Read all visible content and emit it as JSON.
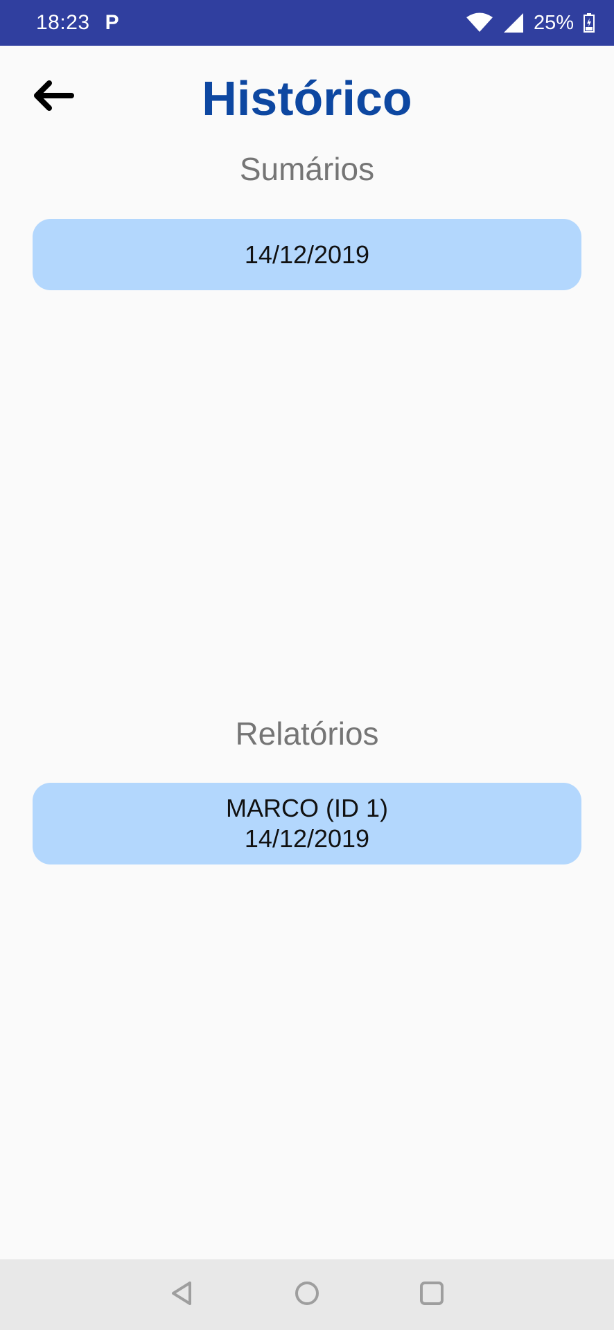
{
  "status_bar": {
    "time": "18:23",
    "notification_icon": "P",
    "battery": "25%",
    "icons": [
      "wifi-icon",
      "signal-icon",
      "battery-icon"
    ]
  },
  "header": {
    "back_icon": "arrow-left-icon",
    "title": "Histórico"
  },
  "summaries": {
    "title": "Sumários",
    "items": [
      {
        "date": "14/12/2019"
      }
    ]
  },
  "reports": {
    "title": "Relatórios",
    "items": [
      {
        "name": "MARCO (ID 1)",
        "date": "14/12/2019"
      }
    ]
  },
  "nav_bar": {
    "icons": [
      "back-triangle-icon",
      "home-circle-icon",
      "recents-square-icon"
    ]
  },
  "colors": {
    "status_bar": "#303f9f",
    "title": "#0d47a1",
    "card": "#b3d7fd",
    "section_title": "#757575",
    "background": "#fafafa"
  }
}
